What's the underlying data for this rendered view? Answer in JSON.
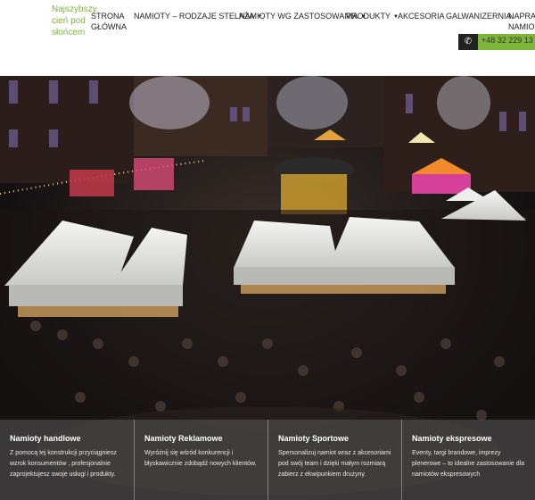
{
  "header": {
    "tagline": "Najszybszy cień pod słońcem",
    "nav": [
      {
        "label": "STRONA GŁÓWNA",
        "dropdown": false
      },
      {
        "label": "NAMIOTY – RODZAJE STELAŻA",
        "dropdown": true
      },
      {
        "label": "NAMIOTY WG ZASTOSOWANIA",
        "dropdown": true
      },
      {
        "label": "PRODUKTY",
        "dropdown": true
      },
      {
        "label": "AKCESORIA",
        "dropdown": false
      },
      {
        "label": "GALWANIZERNIA",
        "dropdown": false
      },
      {
        "label": "NAPRAWA NAMIOTÓW",
        "dropdown": false
      }
    ],
    "phone": "+48 32 229 13 37",
    "phone_icon": "phone-icon",
    "accent_color": "#7cb53a"
  },
  "hero": {
    "scene": "night-market-aerial"
  },
  "cards": [
    {
      "title": "Namioty handlowe",
      "description": "Z pomocą tej konstrukcji przyciągniesz wzrok konsumentów , profesjonalnie zaprojektujesz swoje usługi i produkty."
    },
    {
      "title": "Namioty Reklamowe",
      "description": "Wyróżnij się wśród konkurencji i błyskawicznie zdobądź nowych klientów."
    },
    {
      "title": "Namioty Sportowe",
      "description": "Spersonalizuj namiot wraz z akcesoriami pod swój team i dzięki małym rozmiarą zabierz z ekwipunkiem drużyny."
    },
    {
      "title": "Namioty ekspresowe",
      "description": "Eventy, targi brandowe, imprezy plenerowe – to idealne zastosowanie dla namiotów ekspresowych"
    }
  ]
}
